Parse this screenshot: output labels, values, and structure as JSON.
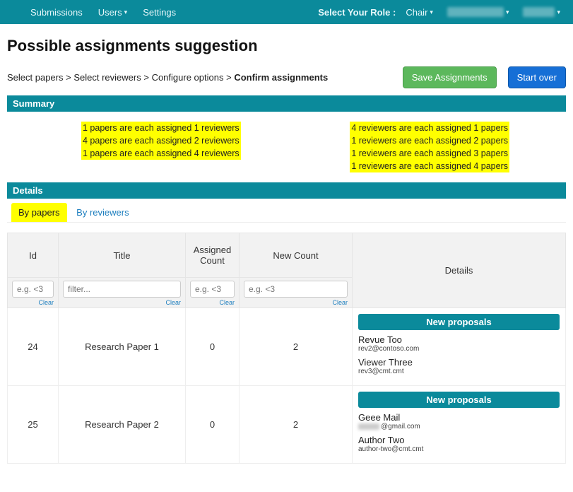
{
  "topnav": {
    "submissions": "Submissions",
    "users": "Users",
    "settings": "Settings",
    "role_label": "Select Your Role :",
    "role_value": "Chair"
  },
  "page_title": "Possible assignments suggestion",
  "breadcrumb": {
    "c1": "Select papers",
    "c2": "Select reviewers",
    "c3": "Configure options",
    "c4": "Confirm assignments",
    "sep": ">"
  },
  "buttons": {
    "save": "Save Assignments",
    "start_over": "Start over"
  },
  "sections": {
    "summary": "Summary",
    "details": "Details"
  },
  "summary": {
    "papers": [
      "1 papers are each assigned 1 reviewers",
      "4 papers are each assigned 2 reviewers",
      "1 papers are each assigned 4 reviewers"
    ],
    "reviewers": [
      "4 reviewers are each assigned 1 papers",
      "1 reviewers are each assigned 2 papers",
      "1 reviewers are each assigned 3 papers",
      "1 reviewers are each assigned 4 papers"
    ]
  },
  "tabs": {
    "by_papers": "By papers",
    "by_reviewers": "By reviewers"
  },
  "table": {
    "headers": {
      "id": "Id",
      "title": "Title",
      "assigned_count": "Assigned Count",
      "new_count": "New Count",
      "details": "Details"
    },
    "filters": {
      "id_ph": "e.g. <3",
      "title_ph": "filter...",
      "ac_ph": "e.g. <3",
      "nc_ph": "e.g. <3",
      "clear": "Clear"
    },
    "np_header": "New proposals",
    "rows": [
      {
        "id": "24",
        "title": "Research Paper 1",
        "assigned": "0",
        "new": "2",
        "reviewers": [
          {
            "name": "Revue Too",
            "email": "rev2@contoso.com",
            "blurprefix": false
          },
          {
            "name": "Viewer Three",
            "email": "rev3@cmt.cmt",
            "blurprefix": false
          }
        ]
      },
      {
        "id": "25",
        "title": "Research Paper 2",
        "assigned": "0",
        "new": "2",
        "reviewers": [
          {
            "name": "Geee Mail",
            "email": "@gmail.com",
            "blurprefix": true
          },
          {
            "name": "Author Two",
            "email": "author-two@cmt.cmt",
            "blurprefix": false
          }
        ]
      }
    ]
  }
}
